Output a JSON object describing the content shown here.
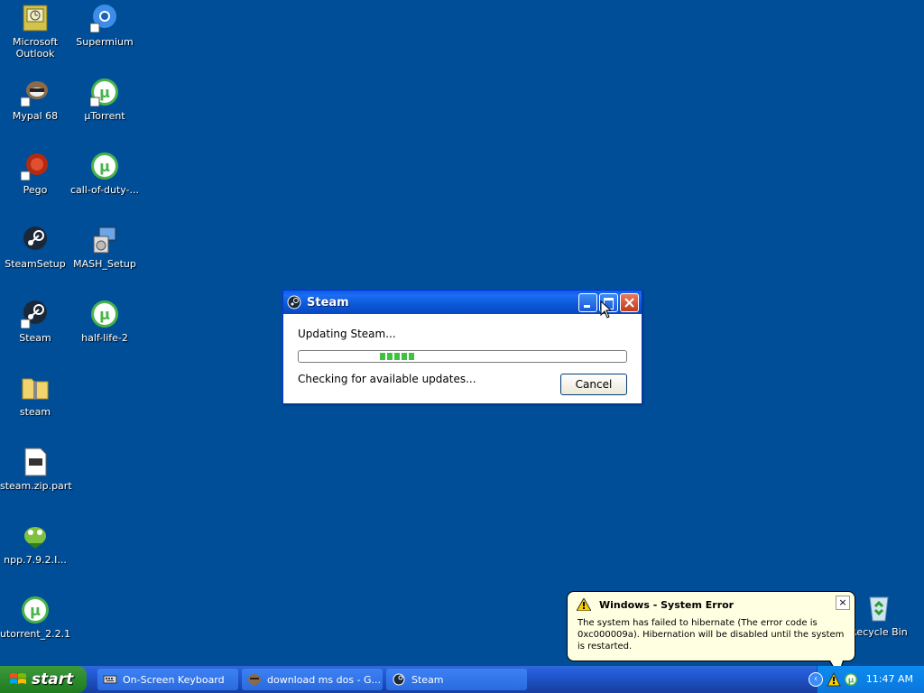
{
  "desktop": {
    "icons": [
      {
        "label": "Microsoft\nOutlook",
        "icon": "outlook-icon"
      },
      {
        "label": "Supermium",
        "icon": "supermium-icon"
      },
      {
        "label": "Mypal 68",
        "icon": "mypal-icon"
      },
      {
        "label": "µTorrent",
        "icon": "utorrent-icon"
      },
      {
        "label": "Pego",
        "icon": "pego-icon"
      },
      {
        "label": "call-of-duty-...",
        "icon": "utorrent-icon"
      },
      {
        "label": "SteamSetup",
        "icon": "steam-icon"
      },
      {
        "label": "MASH_Setup",
        "icon": "installer-icon"
      },
      {
        "label": "Steam",
        "icon": "steam-icon"
      },
      {
        "label": "half-life-2",
        "icon": "utorrent-icon"
      },
      {
        "label": "steam",
        "icon": "zip-folder-icon"
      },
      {
        "label": "steam.zip.part",
        "icon": "file-icon"
      },
      {
        "label": "npp.7.9.2.I...",
        "icon": "notepadpp-icon"
      },
      {
        "label": "utorrent_2.2.1",
        "icon": "utorrent-icon"
      },
      {
        "label": "Recycle Bin",
        "icon": "recycle-bin-icon"
      }
    ]
  },
  "steam_dialog": {
    "title": "Steam",
    "status": "Updating Steam...",
    "checking": "Checking for available updates...",
    "cancel_label": "Cancel"
  },
  "balloon": {
    "title": "Windows - System Error",
    "text": "The system has failed to hibernate (The error code is 0xc000009a).  Hibernation will be disabled until the system is restarted.",
    "close": "×"
  },
  "taskbar": {
    "start_label": "start",
    "tasks": [
      {
        "label": "On-Screen Keyboard"
      },
      {
        "label": "download ms dos - G..."
      },
      {
        "label": "Steam"
      }
    ],
    "clock": "11:47 AM"
  },
  "colors": {
    "desktop": "#004e98",
    "title_bar": "#0a58d8",
    "start_green": "#2d8a2d",
    "balloon": "#ffffe1",
    "progress": "#3fc33f"
  }
}
